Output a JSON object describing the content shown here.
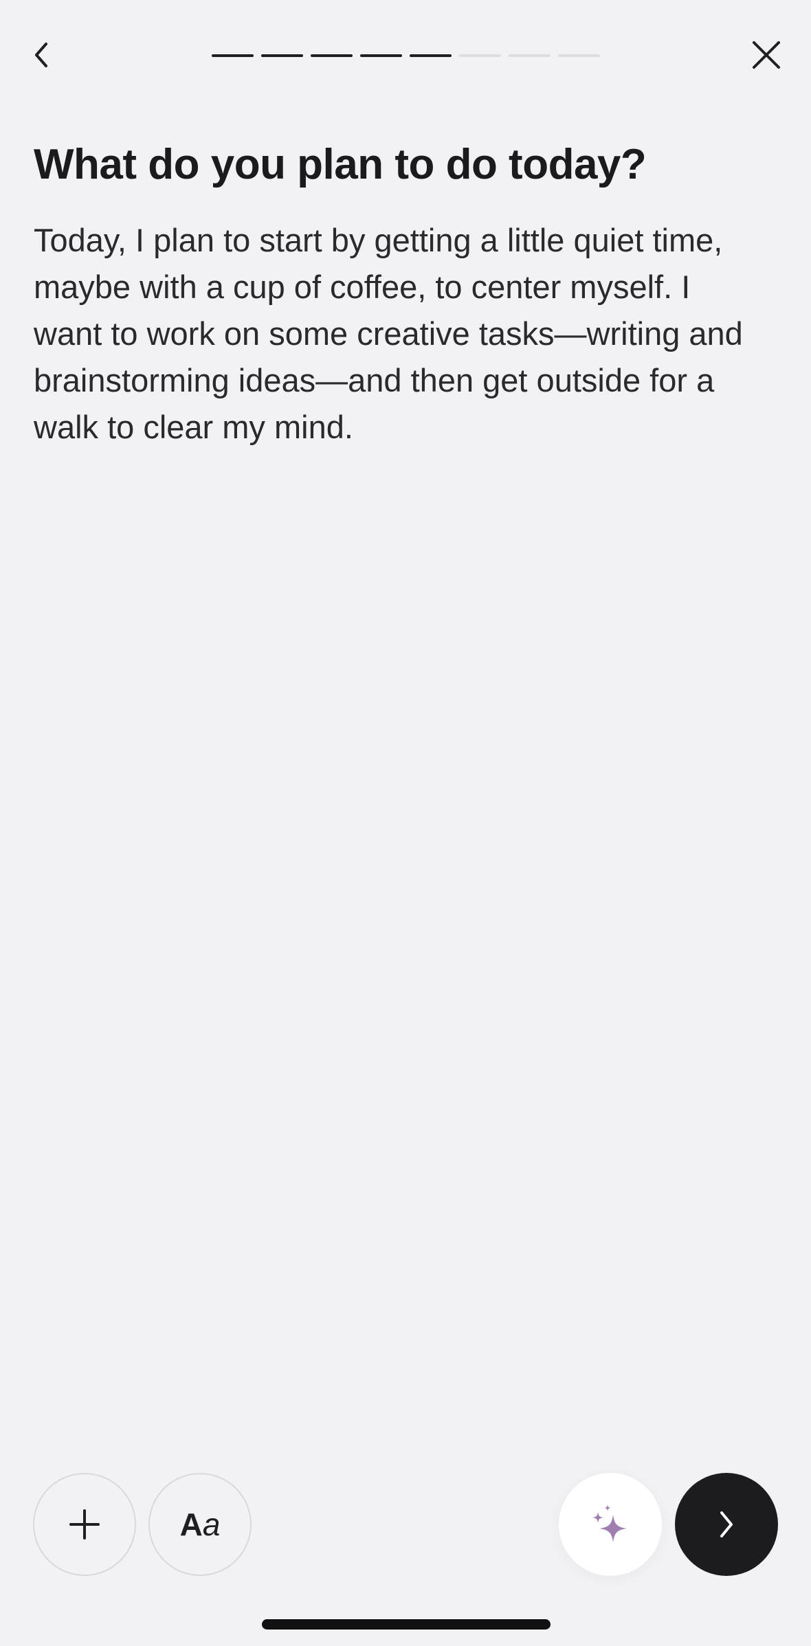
{
  "header": {
    "back_icon": "chevron-left-icon",
    "close_icon": "close-icon",
    "progress": {
      "total_steps": 8,
      "completed_steps": 5
    }
  },
  "prompt": {
    "title": "What do you plan to do today?",
    "entry_text": "Today, I plan to start by getting a little quiet time, maybe with a cup of coffee, to center myself. I want to work on some creative tasks—writing and brainstorming ideas—and then get outside for a walk to clear my mind."
  },
  "toolbar": {
    "add_icon": "plus-icon",
    "format_label_big": "A",
    "format_label_small": "a",
    "ai_icon": "sparkle-icon",
    "next_icon": "chevron-right-icon"
  },
  "colors": {
    "background": "#f2f2f4",
    "text": "#1f1f21",
    "progress_active": "#1f1f21",
    "progress_inactive": "#dedee2",
    "sparkle": "#a07fb0",
    "next_button": "#1c1c1e"
  }
}
